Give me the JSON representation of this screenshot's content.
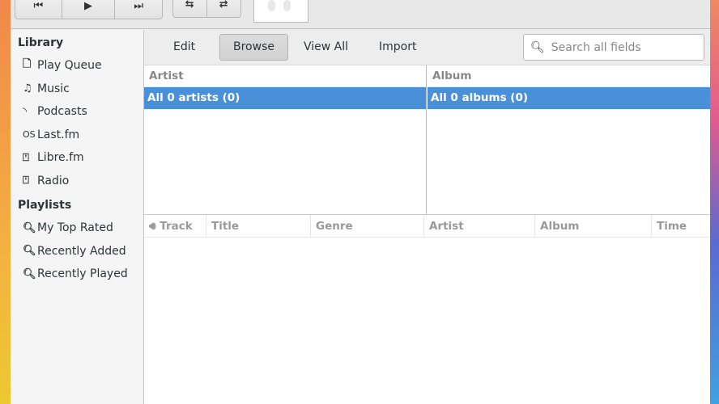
{
  "toolbar": {
    "album_art": "album-art-placeholder"
  },
  "sidebar": {
    "library_heading": "Library",
    "library": [
      {
        "label": "Play Queue",
        "icon": "document-icon"
      },
      {
        "label": "Music",
        "icon": "music-note-icon"
      },
      {
        "label": "Podcasts",
        "icon": "rss-icon"
      },
      {
        "label": "Last.fm",
        "icon": "lastfm-icon"
      },
      {
        "label": "Libre.fm",
        "icon": "radio-icon"
      },
      {
        "label": "Radio",
        "icon": "radio-icon"
      }
    ],
    "playlists_heading": "Playlists",
    "playlists": [
      {
        "label": "My Top Rated"
      },
      {
        "label": "Recently Added"
      },
      {
        "label": "Recently Played"
      }
    ]
  },
  "browser": {
    "edit": "Edit",
    "browse": "Browse",
    "view_all": "View All",
    "import": "Import",
    "search_placeholder": "Search all fields"
  },
  "artist_pane": {
    "header": "Artist",
    "selected": "All 0 artists (0)"
  },
  "album_pane": {
    "header": "Album",
    "selected": "All 0 albums (0)"
  },
  "tracks": {
    "columns": [
      "Track",
      "Title",
      "Genre",
      "Artist",
      "Album",
      "Time"
    ]
  }
}
